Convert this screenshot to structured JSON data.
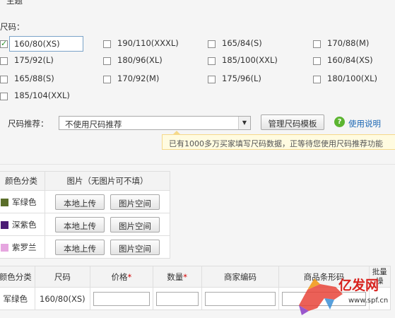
{
  "top_partial_label": "主题",
  "size_section": {
    "label": "尺码：",
    "first_size_value": "160/80(XS)",
    "sizes": [
      {
        "label": "160/80(XS)",
        "checked": true
      },
      {
        "label": "190/110(XXXL)",
        "checked": false
      },
      {
        "label": "165/84(S)",
        "checked": false
      },
      {
        "label": "170/88(M)",
        "checked": false
      },
      {
        "label": "175/92(L)",
        "checked": false
      },
      {
        "label": "180/96(XL)",
        "checked": false
      },
      {
        "label": "185/100(XXL)",
        "checked": false
      },
      {
        "label": "160/84(XS)",
        "checked": false
      },
      {
        "label": "165/88(S)",
        "checked": false
      },
      {
        "label": "170/92(M)",
        "checked": false
      },
      {
        "label": "175/96(L)",
        "checked": false
      },
      {
        "label": "180/100(XL)",
        "checked": false
      },
      {
        "label": "185/104(XXL)",
        "checked": false
      }
    ]
  },
  "recommend": {
    "label": "尺码推荐：",
    "select_value": "不使用尺码推荐",
    "manage_button": "管理尺码模板",
    "help_link": "使用说明",
    "tip": "已有1000多万买家填写尺码数据，正等待您使用尺码推荐功能"
  },
  "color_table": {
    "headers": [
      "颜色分类",
      "图片（无图片可不填）"
    ],
    "rows": [
      {
        "name": "军绿色",
        "color": "#5a6e2a"
      },
      {
        "name": "深紫色",
        "color": "#4b1c74"
      },
      {
        "name": "紫罗兰",
        "color": "#e6a6e0"
      }
    ],
    "upload_button": "本地上传",
    "space_button": "图片空间"
  },
  "sku_table": {
    "headers": [
      "颜色分类",
      "尺码",
      "价格",
      "数量",
      "商家编码",
      "商品条形码",
      "批量"
    ],
    "required_mark": "*",
    "batch_sub": "操",
    "rows": [
      {
        "color": "军绿色",
        "size": "160/80(XS)"
      }
    ]
  },
  "watermark": {
    "text": "亿发网",
    "url": "www.spf.cn"
  }
}
